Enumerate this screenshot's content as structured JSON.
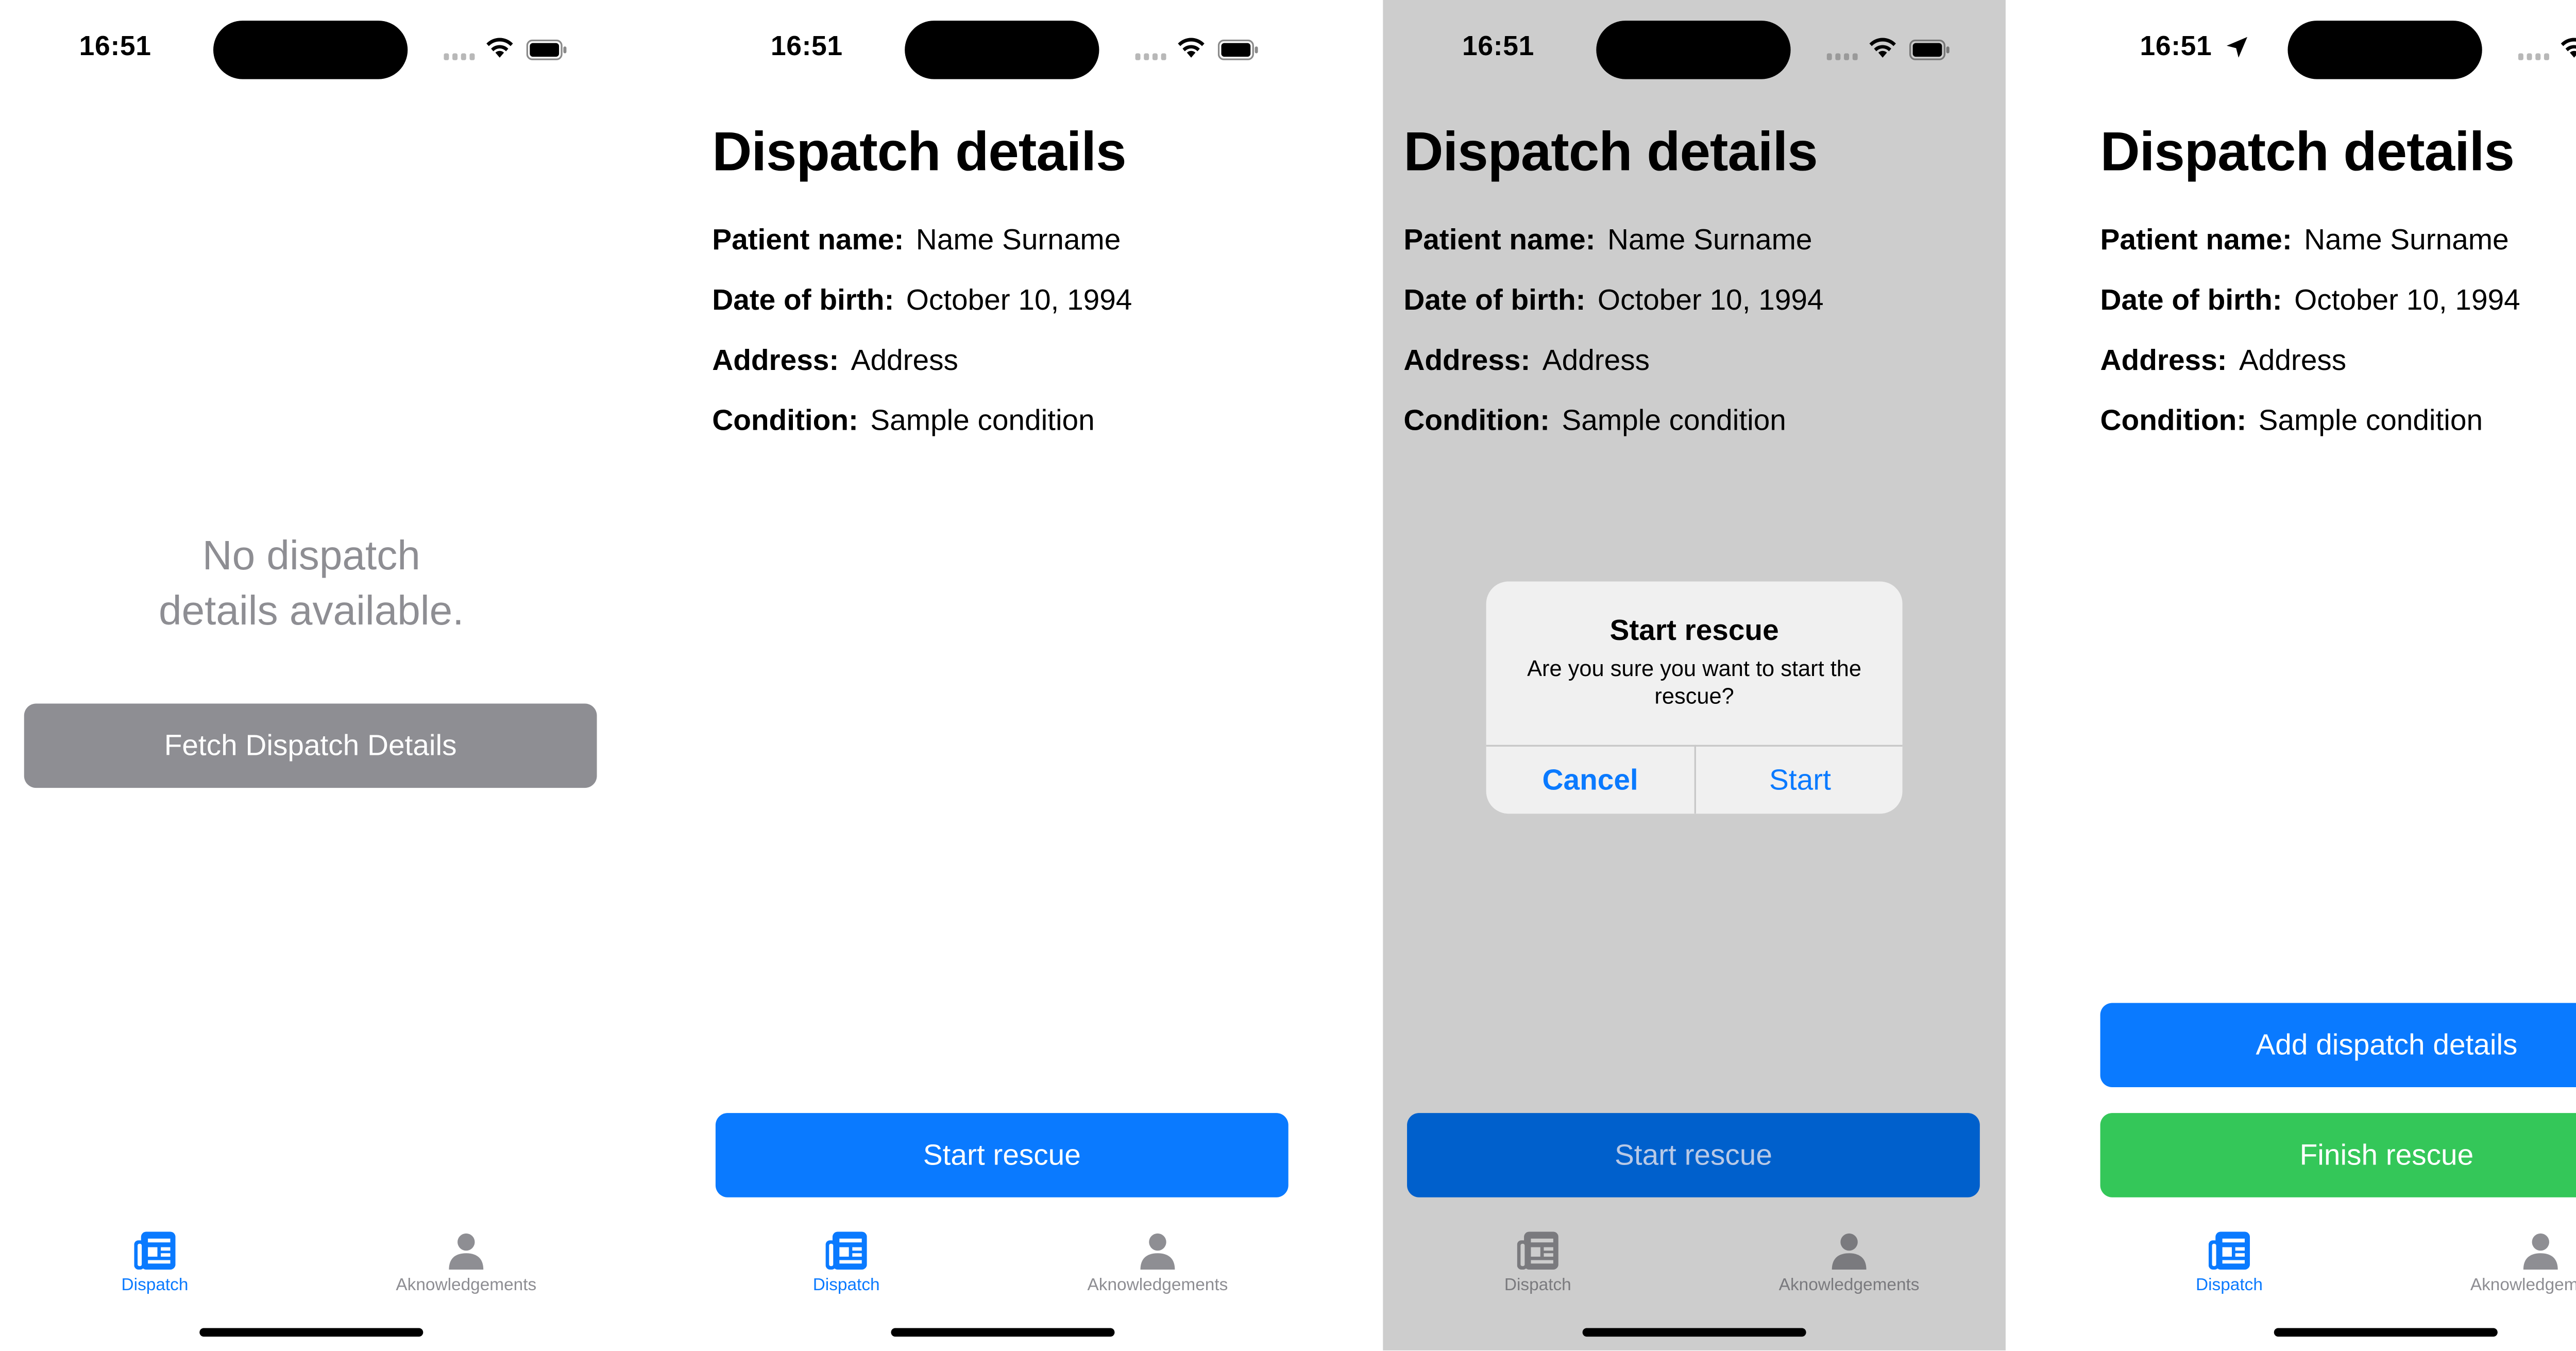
{
  "status_bar": {
    "time": "16:51"
  },
  "colors": {
    "accent": "#0a7aff",
    "gray_button": "#8e8e93",
    "green_button": "#34c759",
    "dim_overlay": "#cdcdcd"
  },
  "tabs": [
    {
      "label": "Dispatch",
      "icon": "newspaper-icon"
    },
    {
      "label": "Aknowledgements",
      "icon": "person-icon"
    }
  ],
  "screen_empty": {
    "message_line1": "No dispatch",
    "message_line2": "details available.",
    "fetch_button": "Fetch Dispatch Details"
  },
  "details": {
    "title": "Dispatch details",
    "fields": [
      {
        "label": "Patient name:",
        "value": "Name Surname"
      },
      {
        "label": "Date of birth:",
        "value": "October 10, 1994"
      },
      {
        "label": "Address:",
        "value": "Address"
      },
      {
        "label": "Condition:",
        "value": "Sample condition"
      }
    ]
  },
  "buttons": {
    "start_rescue": "Start rescue",
    "add_dispatch_details": "Add dispatch details",
    "finish_rescue": "Finish rescue"
  },
  "alert": {
    "title": "Start rescue",
    "message": "Are you sure you want to start the rescue?",
    "cancel": "Cancel",
    "confirm": "Start"
  }
}
